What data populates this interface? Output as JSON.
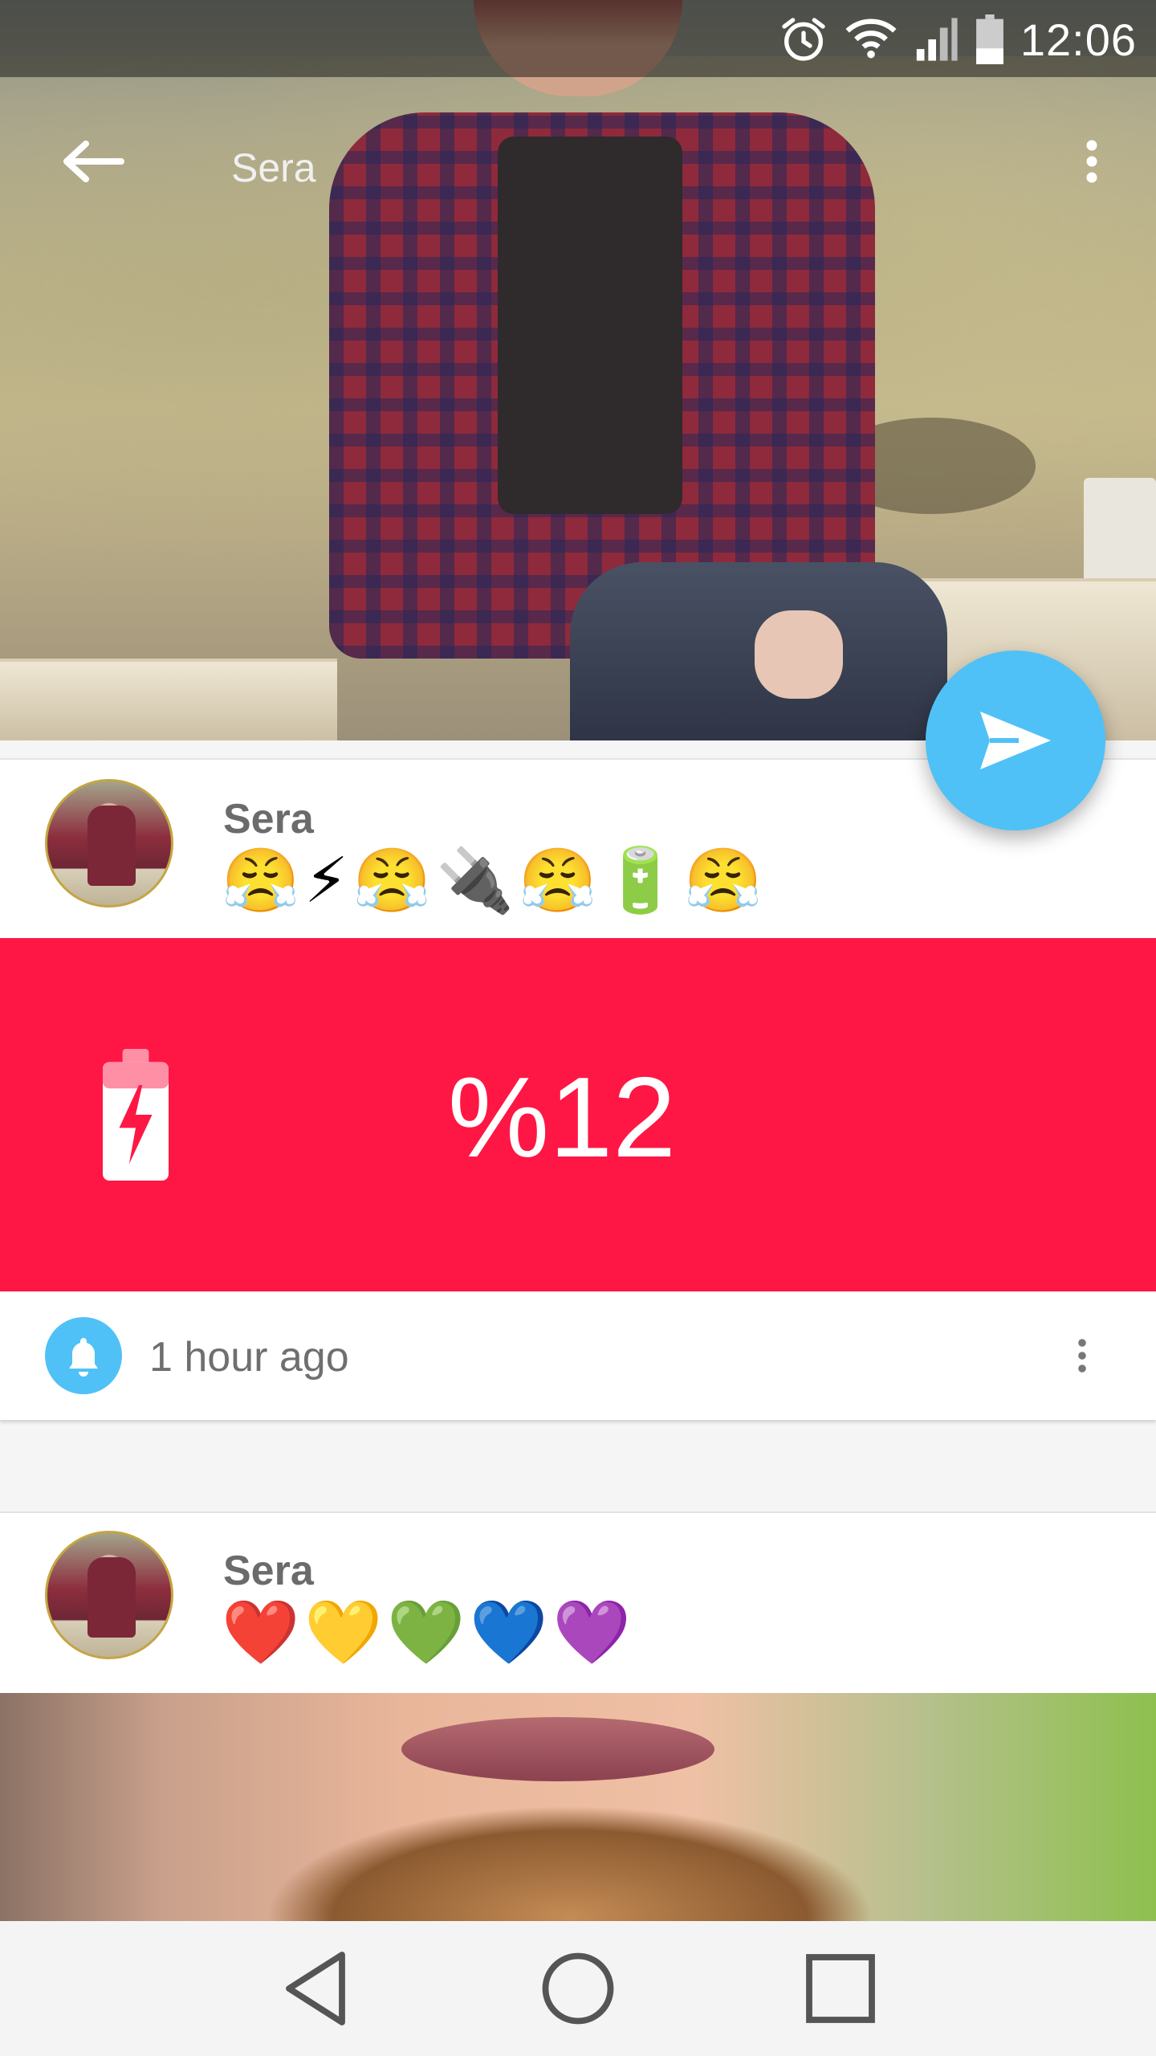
{
  "status_bar": {
    "time": "12:06",
    "icons": [
      "alarm-icon",
      "wifi-icon",
      "signal-icon",
      "battery-icon"
    ]
  },
  "app_bar": {
    "title": "Sera",
    "back_icon": "arrow-back-icon",
    "overflow_icon": "more-vert-icon"
  },
  "fab": {
    "icon": "send-icon",
    "color": "#4fc1f6"
  },
  "posts": [
    {
      "author": "Sera",
      "emoji": "😤⚡😤🔌😤🔋😤",
      "battery": {
        "text": "%12",
        "icon": "battery-charging-icon",
        "background": "#fe1744"
      },
      "time_ago": "1 hour ago",
      "notification_icon": "bell-icon"
    },
    {
      "author": "Sera",
      "emoji": "❤️💛💚💙💜"
    }
  ],
  "navigation": {
    "back": "back-triangle-icon",
    "home": "home-circle-icon",
    "recents": "recents-square-icon"
  },
  "colors": {
    "accent": "#4fc1f6",
    "battery_red": "#fe1744",
    "avatar_ring": "#c4a542"
  }
}
